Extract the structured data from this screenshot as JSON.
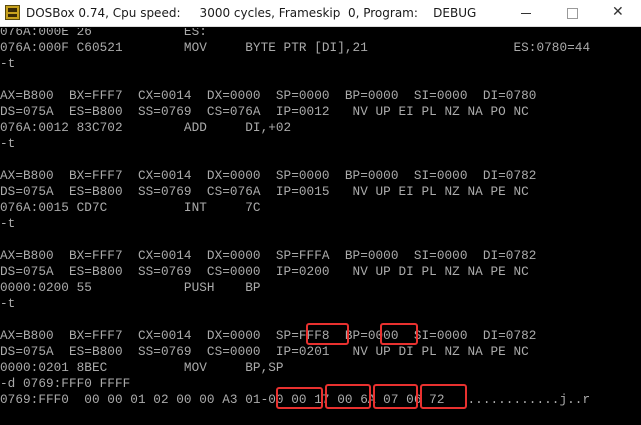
{
  "window": {
    "title": "DOSBox 0.74, Cpu speed:     3000 cycles, Frameskip  0, Program:    DEBUG",
    "icon": "dosbox-app-icon",
    "controls": {
      "minimize": "minimize-icon",
      "maximize": "maximize-icon",
      "close_glyph": "✕"
    }
  },
  "console": {
    "colors": {
      "background": "#000000",
      "text": "#ababab",
      "highlight_border": "#e8312f"
    },
    "lines": [
      "076A:000E 26            ES:",
      "076A:000F C60521        MOV     BYTE PTR [DI],21                   ES:0780=44",
      "-t",
      "",
      "AX=B800  BX=FFF7  CX=0014  DX=0000  SP=0000  BP=0000  SI=0000  DI=0780",
      "DS=075A  ES=B800  SS=0769  CS=076A  IP=0012   NV UP EI PL NZ NA PO NC",
      "076A:0012 83C702        ADD     DI,+02",
      "-t",
      "",
      "AX=B800  BX=FFF7  CX=0014  DX=0000  SP=0000  BP=0000  SI=0000  DI=0782",
      "DS=075A  ES=B800  SS=0769  CS=076A  IP=0015   NV UP EI PL NZ NA PE NC",
      "076A:0015 CD7C          INT     7C",
      "-t",
      "",
      "AX=B800  BX=FFF7  CX=0014  DX=0000  SP=FFFA  BP=0000  SI=0000  DI=0782",
      "DS=075A  ES=B800  SS=0769  CS=0000  IP=0200   NV UP DI PL NZ NA PE NC",
      "0000:0200 55            PUSH    BP",
      "-t",
      "",
      "AX=B800  BX=FFF7  CX=0014  DX=0000  SP=FFF8  BP=0000  SI=0000  DI=0782",
      "DS=075A  ES=B800  SS=0769  CS=0000  IP=0201   NV UP DI PL NZ NA PE NC",
      "0000:0201 8BEC          MOV     BP,SP",
      "-d 0769:FFF0 FFFF",
      "0769:FFF0  00 00 01 02 00 00 A3 01-00 00 17 00 6A 07 06 72   ............j..r"
    ],
    "highlights": [
      "sp-value-fff8",
      "bp-value-0000",
      "stack-bytes-00-00",
      "stack-bytes-17-00",
      "stack-bytes-6a-07",
      "stack-bytes-06-72"
    ]
  }
}
